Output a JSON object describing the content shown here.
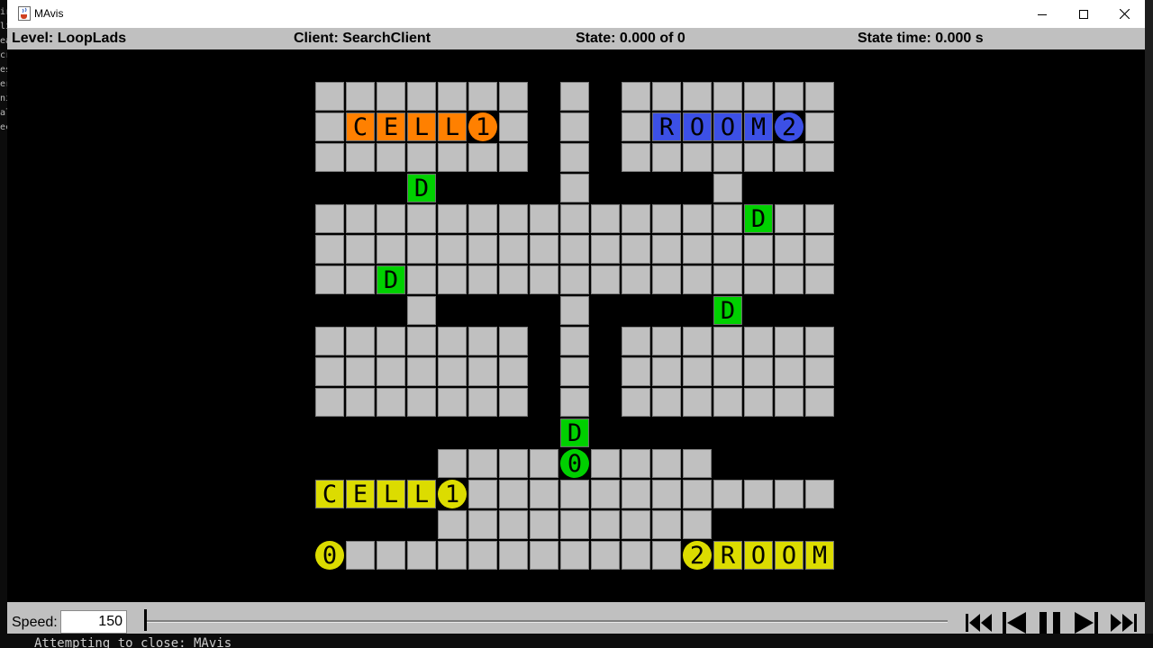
{
  "window": {
    "title": "MAvis"
  },
  "status": {
    "level": "Level: LoopLads",
    "client": "Client: SearchClient",
    "state": "State: 0.000 of 0",
    "state_time": "State time: 0.000 s"
  },
  "controls": {
    "speed_label": "Speed:",
    "speed_value": "150"
  },
  "terminal": {
    "bottom_text": "Attempting to close: MAvis",
    "side_fragments": [
      "ir",
      "li",
      "ea",
      "cr",
      "es",
      "er",
      "ni",
      "al",
      "ec"
    ]
  },
  "colors": {
    "orange": "#ff8000",
    "blue": "#3c50e6",
    "green": "#00d000",
    "yellow": "#dcdc00",
    "floor": "#c0c0c0",
    "wall": "#000000"
  },
  "level_map": [
    "+++++++++++++++++++++++++++",
    "+       + +       +",
    "+ CELL1 + + ROOM2 +",
    "+       + +       +",
    "+++ +++++ +++ ++++",
    "+                 +",
    "+                 +",
    "+                 +",
    "++ ++++ +++ ++++",
    "+       + +       +",
    "+       + +       +",
    "+       + +       +",
    "+++++++++ ++++++++++",
    "+++     0     +++++",
    "+CELL1            +",
    "+++        ++++++",
    "+0          2ROOM+"
  ],
  "floor_rows": [
    {
      "row": 0,
      "cols": [
        0,
        1,
        2,
        3,
        4,
        5,
        6,
        8,
        10,
        11,
        12,
        13,
        14,
        15,
        16
      ]
    },
    {
      "row": 1,
      "cols": [
        0,
        6,
        8,
        10,
        16
      ]
    },
    {
      "row": 2,
      "cols": [
        0,
        1,
        2,
        3,
        4,
        5,
        6,
        8,
        10,
        11,
        12,
        13,
        14,
        15,
        16
      ]
    },
    {
      "row": 3,
      "cols": [
        8,
        13
      ]
    },
    {
      "row": 4,
      "cols": [
        0,
        1,
        2,
        3,
        4,
        5,
        6,
        7,
        8,
        9,
        10,
        11,
        12,
        13,
        15,
        16
      ]
    },
    {
      "row": 5,
      "cols": [
        0,
        1,
        2,
        3,
        4,
        5,
        6,
        7,
        8,
        9,
        10,
        11,
        12,
        13,
        14,
        15,
        16
      ]
    },
    {
      "row": 6,
      "cols": [
        0,
        1,
        3,
        4,
        5,
        6,
        7,
        8,
        9,
        10,
        11,
        12,
        13,
        14,
        15,
        16
      ]
    },
    {
      "row": 7,
      "cols": [
        3,
        8
      ]
    },
    {
      "row": 8,
      "cols": [
        0,
        1,
        2,
        3,
        4,
        5,
        6,
        8,
        10,
        11,
        12,
        13,
        14,
        15,
        16
      ]
    },
    {
      "row": 9,
      "cols": [
        0,
        1,
        2,
        3,
        4,
        5,
        6,
        8,
        10,
        11,
        12,
        13,
        14,
        15,
        16
      ]
    },
    {
      "row": 10,
      "cols": [
        0,
        1,
        2,
        3,
        4,
        5,
        6,
        8,
        10,
        11,
        12,
        13,
        14,
        15,
        16
      ]
    },
    {
      "row": 12,
      "cols": [
        4,
        5,
        6,
        7,
        9,
        10,
        11,
        12
      ]
    },
    {
      "row": 13,
      "cols": [
        5,
        6,
        7,
        8,
        9,
        10,
        11,
        12,
        13,
        14,
        15,
        16
      ]
    },
    {
      "row": 14,
      "cols": [
        4,
        5,
        6,
        7,
        8,
        9,
        10,
        11,
        12
      ]
    },
    {
      "row": 15,
      "cols": [
        1,
        2,
        3,
        4,
        5,
        6,
        7,
        8,
        9,
        10,
        11
      ]
    }
  ],
  "boxes": [
    {
      "row": 1,
      "col": 1,
      "letter": "C",
      "color": "orange"
    },
    {
      "row": 1,
      "col": 2,
      "letter": "E",
      "color": "orange"
    },
    {
      "row": 1,
      "col": 3,
      "letter": "L",
      "color": "orange"
    },
    {
      "row": 1,
      "col": 4,
      "letter": "L",
      "color": "orange"
    },
    {
      "row": 1,
      "col": 11,
      "letter": "R",
      "color": "blue"
    },
    {
      "row": 1,
      "col": 12,
      "letter": "O",
      "color": "blue"
    },
    {
      "row": 1,
      "col": 13,
      "letter": "O",
      "color": "blue"
    },
    {
      "row": 1,
      "col": 14,
      "letter": "M",
      "color": "blue"
    },
    {
      "row": 3,
      "col": 3,
      "letter": "D",
      "color": "green"
    },
    {
      "row": 4,
      "col": 14,
      "letter": "D",
      "color": "green"
    },
    {
      "row": 6,
      "col": 2,
      "letter": "D",
      "color": "green"
    },
    {
      "row": 7,
      "col": 13,
      "letter": "D",
      "color": "green"
    },
    {
      "row": 11,
      "col": 8,
      "letter": "D",
      "color": "green"
    }
  ],
  "agents": [
    {
      "row": 1,
      "col": 5,
      "label": "1",
      "color": "orange"
    },
    {
      "row": 1,
      "col": 15,
      "label": "2",
      "color": "blue"
    },
    {
      "row": 12,
      "col": 8,
      "label": "0",
      "color": "green"
    }
  ],
  "goals": [
    {
      "row": 13,
      "col": 0,
      "label": "C",
      "color": "yellow",
      "kind": "box"
    },
    {
      "row": 13,
      "col": 1,
      "label": "E",
      "color": "yellow",
      "kind": "box"
    },
    {
      "row": 13,
      "col": 2,
      "label": "L",
      "color": "yellow",
      "kind": "box"
    },
    {
      "row": 13,
      "col": 3,
      "label": "L",
      "color": "yellow",
      "kind": "box"
    },
    {
      "row": 13,
      "col": 4,
      "label": "1",
      "color": "yellow",
      "kind": "agent"
    },
    {
      "row": 15,
      "col": 0,
      "label": "0",
      "color": "yellow",
      "kind": "agent"
    },
    {
      "row": 15,
      "col": 12,
      "label": "2",
      "color": "yellow",
      "kind": "agent"
    },
    {
      "row": 15,
      "col": 13,
      "label": "R",
      "color": "yellow",
      "kind": "box"
    },
    {
      "row": 15,
      "col": 14,
      "label": "O",
      "color": "yellow",
      "kind": "box"
    },
    {
      "row": 15,
      "col": 15,
      "label": "O",
      "color": "yellow",
      "kind": "box"
    },
    {
      "row": 15,
      "col": 16,
      "label": "M",
      "color": "yellow",
      "kind": "box"
    }
  ],
  "icons": [
    "java-cup-icon",
    "minimize-icon",
    "maximize-icon",
    "close-icon",
    "skip-to-start-icon",
    "step-back-icon",
    "pause-icon",
    "step-forward-icon",
    "skip-to-end-icon"
  ]
}
